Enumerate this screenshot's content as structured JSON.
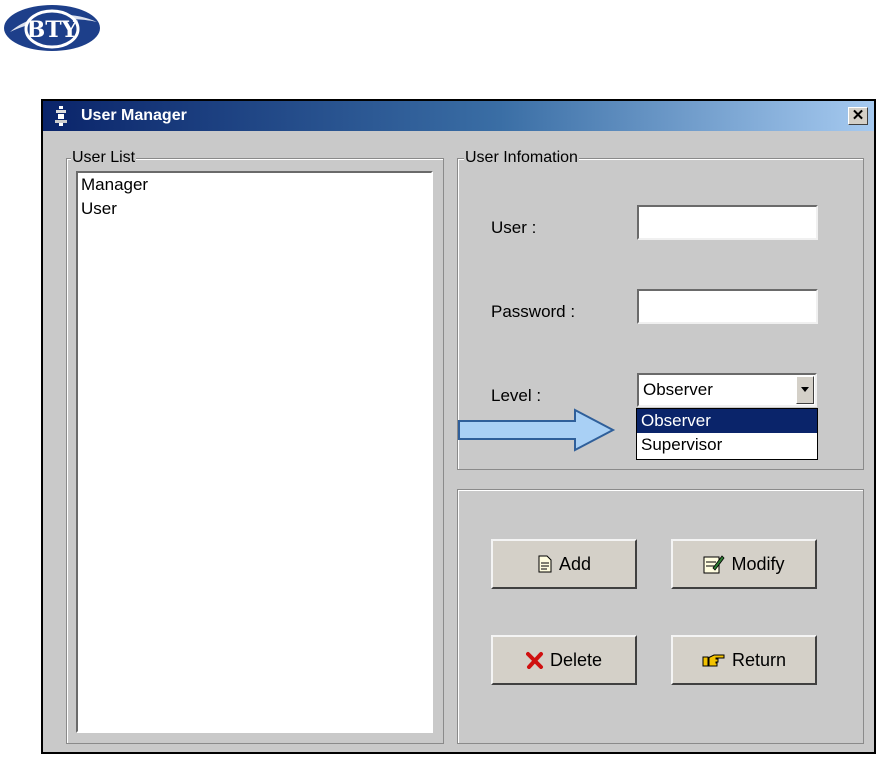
{
  "logo": {
    "text": "BTY"
  },
  "window": {
    "title": "User Manager",
    "close_label": "✕"
  },
  "user_list": {
    "legend": "User List",
    "items": [
      "Manager",
      "User"
    ]
  },
  "user_info": {
    "legend": "User Infomation",
    "user_label": "User :",
    "user_value": "",
    "password_label": "Password :",
    "password_value": "",
    "level_label": "Level :",
    "level_value": "Observer",
    "level_options": [
      "Observer",
      "Supervisor"
    ],
    "level_selected_index": 0
  },
  "buttons": {
    "add": "Add",
    "modify": "Modify",
    "delete": "Delete",
    "return": "Return"
  },
  "icons": {
    "title": "user-manager-icon",
    "add": "document-add-icon",
    "modify": "edit-icon",
    "delete": "red-x-icon",
    "return": "pointing-hand-icon"
  },
  "colors": {
    "titlebar_start": "#0a246a",
    "titlebar_end": "#a6caf0",
    "selection": "#0a246a",
    "arrow_fill": "#a9d0f5"
  }
}
